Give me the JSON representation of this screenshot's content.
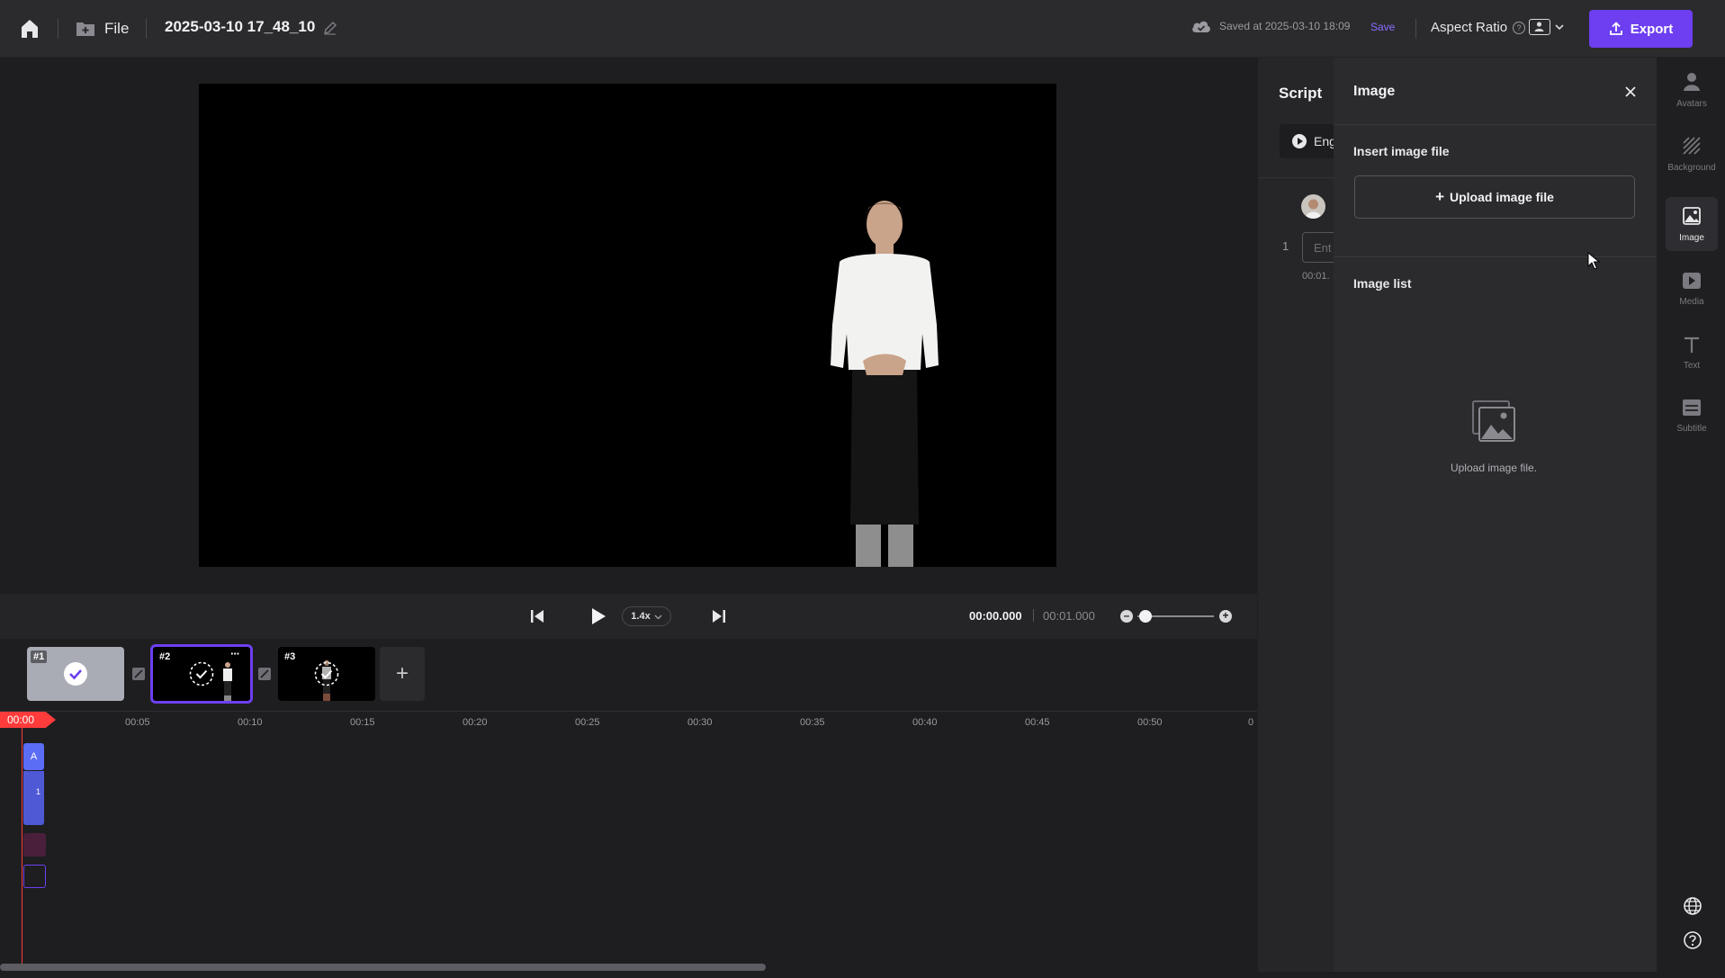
{
  "header": {
    "file_label": "File",
    "project_title": "2025-03-10 17_48_10",
    "saved_status": "Saved at 2025-03-10 18:09",
    "save_label": "Save",
    "aspect_ratio_label": "Aspect Ratio",
    "aspect_help": "?",
    "export_label": "Export",
    "accent_color": "#6d3ff0"
  },
  "player": {
    "speed": "1.4x",
    "current_time": "00:00.000",
    "total_time": "00:01.000"
  },
  "scenes": [
    {
      "number": "#1",
      "selected": false
    },
    {
      "number": "#2",
      "selected": true,
      "menu": "···"
    },
    {
      "number": "#3",
      "selected": false
    }
  ],
  "add_scene_label": "+",
  "timeline": {
    "playhead": "00:00",
    "ticks": [
      "00:05",
      "00:10",
      "00:15",
      "00:20",
      "00:25",
      "00:30",
      "00:35",
      "00:40",
      "00:45",
      "00:50",
      "0"
    ],
    "track_a_label": "A",
    "track_b_label": "1"
  },
  "script": {
    "title": "Script",
    "language_partial": "Eng",
    "line_number": "1",
    "input_placeholder_partial": "Ent",
    "time_partial": "00:01."
  },
  "image_panel": {
    "title": "Image",
    "insert_label": "Insert image file",
    "upload_button": "Upload image file",
    "list_label": "Image list",
    "empty_text": "Upload image file."
  },
  "rail": [
    {
      "label": "Avatars",
      "icon": "person-icon"
    },
    {
      "label": "Background",
      "icon": "hatch-icon"
    },
    {
      "label": "Image",
      "icon": "image-icon",
      "active": true
    },
    {
      "label": "Media",
      "icon": "play-icon"
    },
    {
      "label": "Text",
      "icon": "text-icon"
    },
    {
      "label": "Subtitle",
      "icon": "subtitle-icon"
    }
  ]
}
